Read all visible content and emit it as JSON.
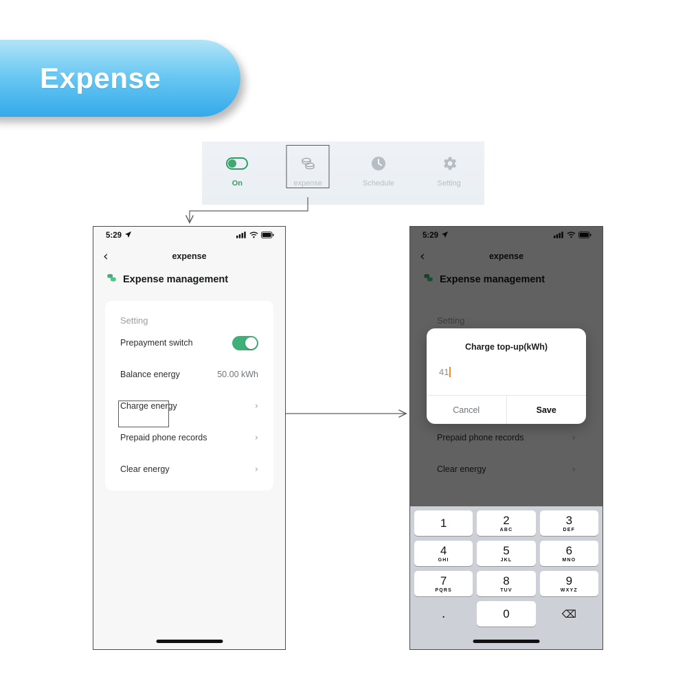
{
  "banner": {
    "label": "Expense"
  },
  "toolbar": {
    "items": [
      {
        "label": "On",
        "icon": "toggle-on-icon",
        "selected": false
      },
      {
        "label": "expense",
        "icon": "coins-icon",
        "selected": true
      },
      {
        "label": "Schedule",
        "icon": "clock-icon",
        "selected": false
      },
      {
        "label": "Setting",
        "icon": "gear-icon",
        "selected": false
      }
    ]
  },
  "phone_left": {
    "status": {
      "time": "5:29",
      "location_icon": "location-arrow-icon",
      "signal_icon": "signal-bars-icon",
      "wifi_icon": "wifi-icon",
      "battery_icon": "battery-icon"
    },
    "nav": {
      "back_icon": "chevron-left-icon",
      "title": "expense"
    },
    "page_header": {
      "icon": "coins-icon",
      "text": "Expense management"
    },
    "card": {
      "title": "Setting",
      "rows": [
        {
          "label": "Prepayment switch",
          "type": "toggle",
          "value": "on"
        },
        {
          "label": "Balance energy",
          "type": "value",
          "value": "50.00 kWh"
        },
        {
          "label": "Charge energy",
          "type": "link",
          "value": "",
          "highlighted": true
        },
        {
          "label": "Prepaid phone records",
          "type": "link",
          "value": ""
        },
        {
          "label": "Clear energy",
          "type": "link",
          "value": ""
        }
      ]
    }
  },
  "phone_right": {
    "status": {
      "time": "5:29",
      "location_icon": "location-arrow-icon",
      "signal_icon": "signal-bars-icon",
      "wifi_icon": "wifi-icon",
      "battery_icon": "battery-icon"
    },
    "nav": {
      "back_icon": "chevron-left-icon",
      "title": "expense"
    },
    "page_header": {
      "icon": "coins-icon",
      "text": "Expense management"
    },
    "card": {
      "title": "Setting",
      "rows": [
        {
          "label": "Prepaid phone records",
          "type": "link",
          "value": ""
        },
        {
          "label": "Clear energy",
          "type": "link",
          "value": ""
        }
      ]
    },
    "dialog": {
      "title": "Charge top-up(kWh)",
      "input_value": "41",
      "cancel_label": "Cancel",
      "save_label": "Save"
    },
    "keypad": {
      "keys": [
        {
          "num": "1",
          "sub": ""
        },
        {
          "num": "2",
          "sub": "ABC"
        },
        {
          "num": "3",
          "sub": "DEF"
        },
        {
          "num": "4",
          "sub": "GHI"
        },
        {
          "num": "5",
          "sub": "JKL"
        },
        {
          "num": "6",
          "sub": "MNO"
        },
        {
          "num": "7",
          "sub": "PQRS"
        },
        {
          "num": "8",
          "sub": "TUV"
        },
        {
          "num": "9",
          "sub": "WXYZ"
        }
      ],
      "dot": ".",
      "zero": "0",
      "backspace_icon": "backspace-icon"
    }
  },
  "colors": {
    "banner_start": "#b3e4f7",
    "banner_end": "#34a9ea",
    "accent_green": "#3fb178",
    "toolbar_bg": "#eef2f6",
    "caret_orange": "#f08a24",
    "annotation": "#58595b"
  }
}
